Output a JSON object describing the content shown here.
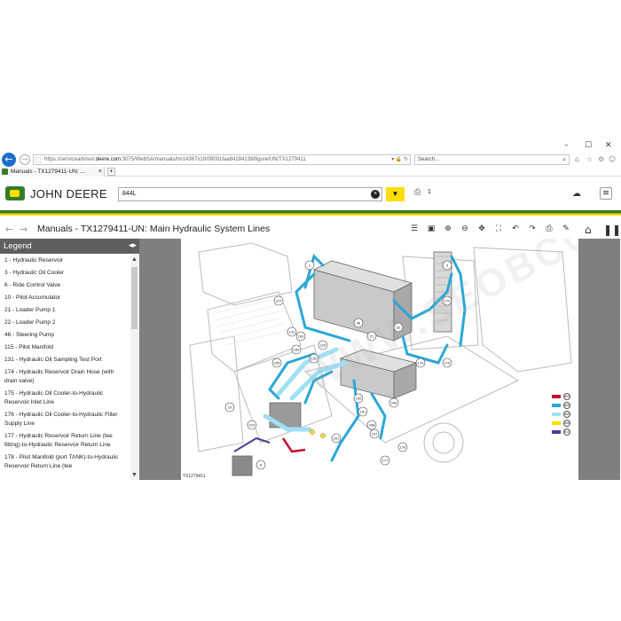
{
  "browser": {
    "url_prefix": "https://serviceadvisor.",
    "url_domain": "deere.com",
    "url_rest": ":3075/WebSA/manuals/tm14367x19/09001faa84284139/figure/UN/TX1279411",
    "search_placeholder": "Search...",
    "tab_title": "Manuals - TX1279411-UN: ...",
    "tab_close": "×",
    "new_tab": "+",
    "win_min": "–",
    "win_max": "☐",
    "win_close": "✕"
  },
  "header": {
    "brand": "JOHN DEERE",
    "model": "844L",
    "clear": "×",
    "dropdown": "▼",
    "cart_count": "1",
    "menu": "≡"
  },
  "manual": {
    "title": "Manuals - TX1279411-UN: Main Hydraulic System Lines"
  },
  "legend": {
    "title": "Legend",
    "items": [
      "1 - Hydraulic Reservoir",
      "3 - Hydraulic Oil Cooler",
      "6 - Ride Control Valve",
      "10 - Pilot Accumulator",
      "21 - Loader Pump 1",
      "22 - Loader Pump 2",
      "46 - Steering Pump",
      "115 - Pilot Manifold",
      "131 - Hydraulic Oil Sampling Test Port",
      "174 - Hydraulic Reservoir Drain Hose (with drain valve)",
      "175 - Hydraulic Oil Cooler-to-Hydraulic Reservoir Inlet Line",
      "176 - Hydraulic Oil Cooler-to-Hydraulic Filter Supply Line",
      "177 - Hydraulic Reservoir Return Line (tee fitting)-to-Hydraulic Reservoir Return Line",
      "178 - Pilot Manifold (port TANK)-to-Hydraulic Reservoir Return Line (tee"
    ]
  },
  "figure": {
    "id": "TX1279411",
    "watermark": "WWW.SEOBCOM",
    "callouts": [
      "1",
      "3",
      "6",
      "10",
      "21",
      "22",
      "46",
      "115",
      "131",
      "174",
      "175",
      "176",
      "177",
      "178",
      "181",
      "189",
      "190",
      "193",
      "196",
      "201",
      "219",
      "227",
      "237",
      "246",
      "248",
      "255"
    ],
    "line_key": [
      {
        "color": "#c8102e",
        "code": "883"
      },
      {
        "color": "#2aa7d6",
        "code": "885"
      },
      {
        "color": "#9fe0f5",
        "code": "889"
      },
      {
        "color": "#ffe000",
        "code": "886"
      },
      {
        "color": "#4a3b9a",
        "code": "810"
      }
    ]
  }
}
